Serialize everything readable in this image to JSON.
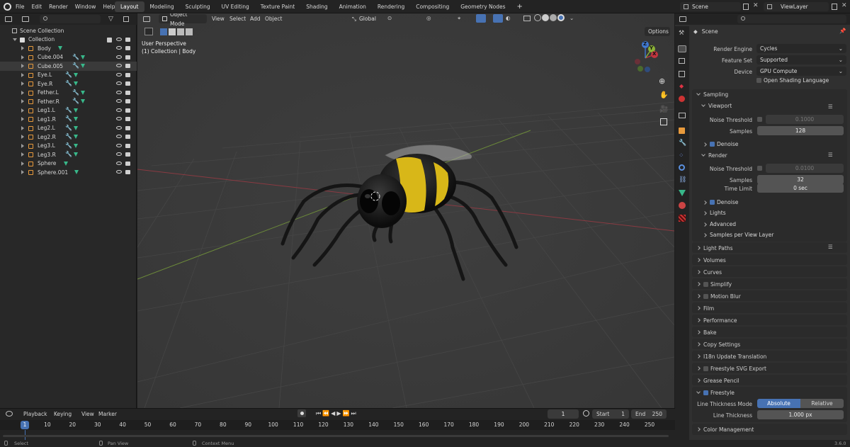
{
  "menu": [
    "File",
    "Edit",
    "Render",
    "Window",
    "Help"
  ],
  "workspaces": [
    "Layout",
    "Modeling",
    "Sculpting",
    "UV Editing",
    "Texture Paint",
    "Shading",
    "Animation",
    "Rendering",
    "Compositing",
    "Geometry Nodes"
  ],
  "scene_field": "Scene",
  "viewlayer_field": "ViewLayer",
  "outliner": {
    "scene_collection": "Scene Collection",
    "collection": "Collection",
    "items": [
      "Body",
      "Cube.004",
      "Cube.005",
      "Eye.L",
      "Eye.R",
      "Fether.L",
      "Fether.R",
      "Leg1.L",
      "Leg1.R",
      "Leg2.L",
      "Leg2.R",
      "Leg3.L",
      "Leg3.R",
      "Sphere",
      "Sphere.001"
    ]
  },
  "viewport": {
    "mode": "Object Mode",
    "menus": [
      "View",
      "Select",
      "Add",
      "Object"
    ],
    "orientation": "Global",
    "options": "Options",
    "perspective": "User Perspective",
    "collection_label": "(1) Collection | Body",
    "gizmo": {
      "x": "X",
      "y": "Y",
      "z": "Z"
    }
  },
  "properties": {
    "title": "Scene",
    "render_engine_label": "Render Engine",
    "render_engine": "Cycles",
    "feature_set_label": "Feature Set",
    "feature_set": "Supported",
    "device_label": "Device",
    "device": "GPU Compute",
    "osl": "Open Shading Language",
    "sampling": "Sampling",
    "viewport": "Viewport",
    "noise_threshold_label": "Noise Threshold",
    "vp_noise": "0.1000",
    "samples_label": "Samples",
    "vp_samples": "128",
    "denoise": "Denoise",
    "render": "Render",
    "r_noise": "0.0100",
    "r_samples": "32",
    "time_limit_label": "Time Limit",
    "time_limit": "0 sec",
    "lights": "Lights",
    "advanced": "Advanced",
    "samples_per_view_layer": "Samples per View Layer",
    "sections": [
      "Light Paths",
      "Volumes",
      "Curves",
      "Simplify",
      "Motion Blur",
      "Film",
      "Performance",
      "Bake",
      "Copy Settings",
      "I18n Update Translation",
      "Freestyle SVG Export",
      "Grease Pencil",
      "Freestyle"
    ],
    "line_thickness_mode_label": "Line Thickness Mode",
    "absolute": "Absolute",
    "relative": "Relative",
    "line_thickness_label": "Line Thickness",
    "line_thickness": "1.000 px",
    "color_management": "Color Management"
  },
  "timeline": {
    "menus": [
      "Playback",
      "Keying",
      "View",
      "Marker"
    ],
    "current_frame": "1",
    "start_label": "Start",
    "start": "1",
    "end_label": "End",
    "end": "250",
    "ticks": [
      "1",
      "10",
      "20",
      "30",
      "40",
      "50",
      "60",
      "70",
      "80",
      "90",
      "100",
      "110",
      "120",
      "130",
      "140",
      "150",
      "160",
      "170",
      "180",
      "190",
      "200",
      "210",
      "220",
      "230",
      "240",
      "250"
    ],
    "playhead": "1"
  },
  "status": {
    "select": "Select",
    "pan": "Pan View",
    "context": "Context Menu",
    "version": "3.6.0"
  },
  "colors": {
    "accent": "#4772b3",
    "mesh": "#38b88a",
    "bee_yellow": "#e8c81a",
    "x_axis": "#c0353f",
    "y_axis": "#8bb237"
  }
}
